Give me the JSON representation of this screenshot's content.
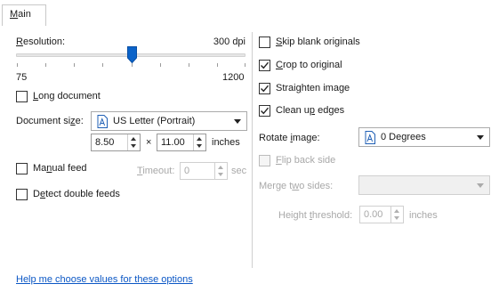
{
  "tabs": [
    {
      "label": "Main",
      "mnemonic": "M",
      "rest": "ain"
    }
  ],
  "resolution": {
    "label_mn": "R",
    "label_rest": "esolution:",
    "value_text": "300 dpi",
    "slider_value": 300,
    "min_label": "75",
    "max_label": "1200"
  },
  "long_document": {
    "label_pre": "",
    "label_mn": "L",
    "label_post": "ong document",
    "checked": false
  },
  "document_size": {
    "label_pre": "Document si",
    "label_mn": "z",
    "label_post": "e:",
    "selected": "US Letter (Portrait)",
    "icon": "document-icon",
    "width": "8.50",
    "height": "11.00",
    "times": "×",
    "unit": "inches"
  },
  "manual_feed": {
    "label_pre": "Ma",
    "label_mn": "n",
    "label_post": "ual feed",
    "checked": false
  },
  "timeout": {
    "label_pre": "",
    "label_mn": "T",
    "label_post": "imeout:",
    "value": "0",
    "unit": "sec"
  },
  "detect_double_feeds": {
    "label_pre": "D",
    "label_mn": "e",
    "label_post": "tect double feeds",
    "checked": false
  },
  "skip_blank": {
    "label_pre": "",
    "label_mn": "S",
    "label_post": "kip blank originals",
    "checked": false
  },
  "crop": {
    "label_pre": "",
    "label_mn": "C",
    "label_post": "rop to original",
    "checked": true
  },
  "straighten": {
    "label_pre": "Strai",
    "label_mn": "g",
    "label_post": "hten image",
    "checked": true
  },
  "clean_edges": {
    "label_pre": "Clean u",
    "label_mn": "p",
    "label_post": " edges",
    "checked": true
  },
  "rotate": {
    "label_pre": "Rotate ",
    "label_mn": "i",
    "label_post": "mage:",
    "selected": "0 Degrees",
    "icon": "document-icon"
  },
  "flip_back": {
    "label_pre": "",
    "label_mn": "F",
    "label_post": "lip back side",
    "checked": false
  },
  "merge": {
    "label_pre": "Merge t",
    "label_mn": "w",
    "label_post": "o sides:",
    "selected": ""
  },
  "height_threshold": {
    "label_pre": "Height ",
    "label_mn": "t",
    "label_post": "hreshold:",
    "value": "0.00",
    "unit": "inches"
  },
  "help_link": "Help me choose values for these options",
  "colors": {
    "accent": "#0b63c9",
    "link": "#0b57c5",
    "disabled": "#a8a8a8"
  }
}
